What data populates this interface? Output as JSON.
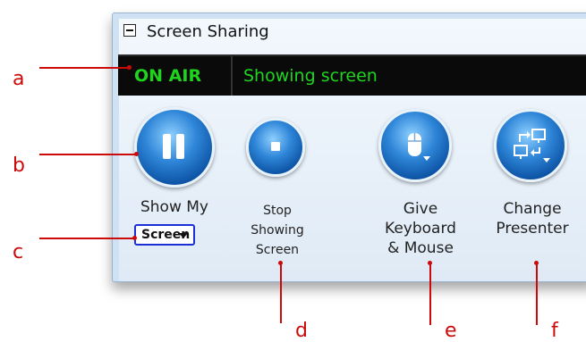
{
  "window": {
    "title": "Screen Sharing",
    "status_label": "ON AIR",
    "status_text": "Showing screen"
  },
  "controls": {
    "show_my_label": "Show My",
    "show_dropdown_value": "Screen",
    "stop_label_1": "Stop",
    "stop_label_2": "Showing",
    "stop_label_3": "Screen",
    "give_label_1": "Give",
    "give_label_2": "Keyboard",
    "give_label_3": "& Mouse",
    "change_label_1": "Change",
    "change_label_2": "Presenter"
  },
  "annotations": [
    "a",
    "b",
    "c",
    "d",
    "e",
    "f"
  ],
  "colors": {
    "status_green": "#1ed51e",
    "annotation_red": "#cc0a0a",
    "button_blue": "#1a6cc4"
  },
  "icons": [
    "collapse-icon",
    "pause-icon",
    "stop-icon",
    "mouse-icon",
    "presenter-icon",
    "chevron-down-icon"
  ]
}
